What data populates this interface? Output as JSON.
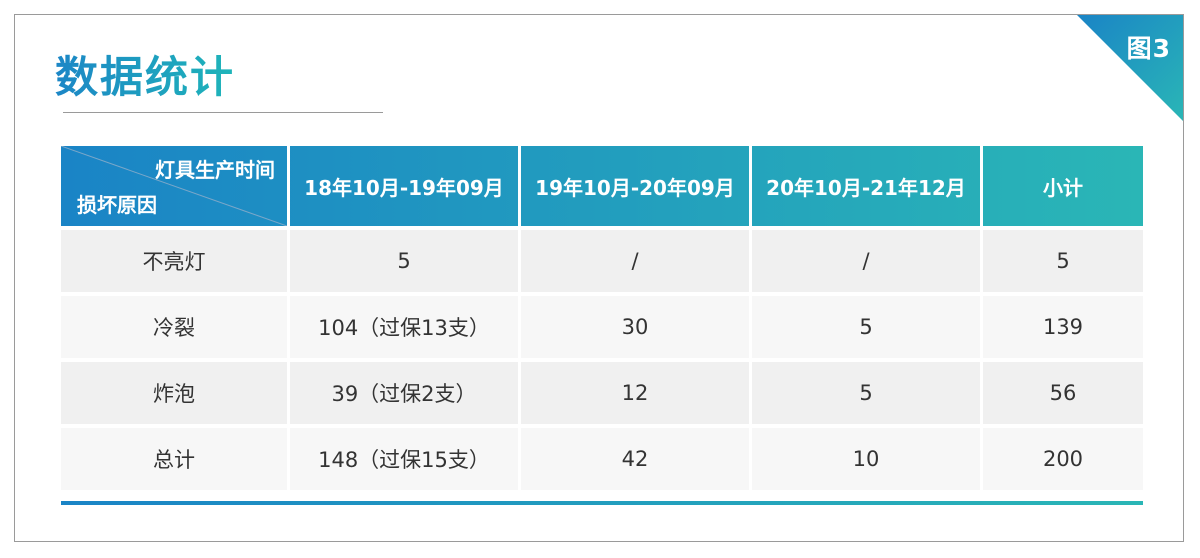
{
  "figure_label": "图3",
  "title": "数据统计",
  "table": {
    "header_diag_top": "灯具生产时间",
    "header_diag_bottom": "损坏原因",
    "columns": [
      "18年10月-19年09月",
      "19年10月-20年09月",
      "20年10月-21年12月",
      "小计"
    ],
    "rows": [
      [
        "不亮灯",
        "5",
        "/",
        "/",
        "5"
      ],
      [
        "冷裂",
        "104（过保13支）",
        "30",
        "5",
        "139"
      ],
      [
        "炸泡",
        "39（过保2支）",
        "12",
        "5",
        "56"
      ],
      [
        "总计",
        "148（过保15支）",
        "42",
        "10",
        "200"
      ]
    ]
  },
  "colors": {
    "accent_start": "#1a84c6",
    "accent_end": "#2ab6b6",
    "row_bg": "#f0f0f0",
    "text": "#333333"
  }
}
